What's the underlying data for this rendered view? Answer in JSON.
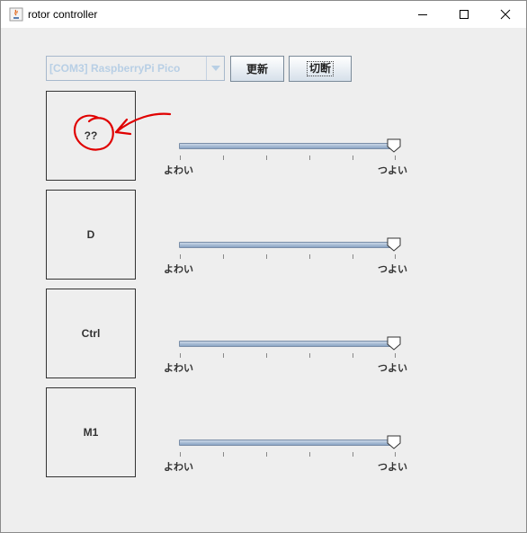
{
  "window": {
    "title": "rotor controller"
  },
  "port": {
    "selected": "[COM3] RaspberryPi Pico"
  },
  "buttons": {
    "refresh": "更新",
    "disconnect": "切断"
  },
  "controls": [
    {
      "label": "??",
      "min_label": "よわい",
      "max_label": "つよい",
      "level": 1.0
    },
    {
      "label": "D",
      "min_label": "よわい",
      "max_label": "つよい",
      "level": 1.0
    },
    {
      "label": "Ctrl",
      "min_label": "よわい",
      "max_label": "つよい",
      "level": 1.0
    },
    {
      "label": "M1",
      "min_label": "よわい",
      "max_label": "つよい",
      "level": 1.0
    }
  ],
  "icons": [
    "java-app-icon",
    "minimize-icon",
    "maximize-icon",
    "close-icon",
    "dropdown-arrow-icon",
    "slider-thumb-icon"
  ],
  "colors": {
    "annotation": "#e00000",
    "combo_text": "#b8cfe5"
  }
}
